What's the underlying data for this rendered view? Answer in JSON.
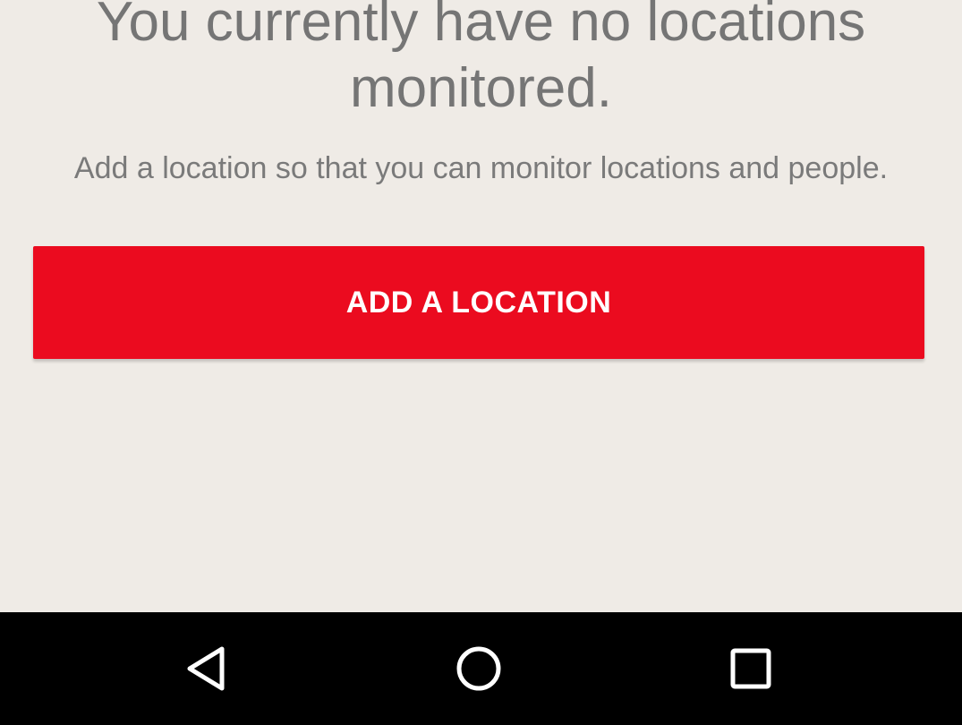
{
  "empty_state": {
    "title": "You currently have no locations monitored.",
    "subtitle": "Add a location so that you can monitor locations and people.",
    "button_label": "ADD A LOCATION"
  },
  "nav_bar": {
    "buttons": [
      {
        "name": "back",
        "icon": "triangle-back-icon"
      },
      {
        "name": "home",
        "icon": "circle-home-icon"
      },
      {
        "name": "recents",
        "icon": "square-recents-icon"
      }
    ]
  },
  "colors": {
    "background": "#efebe6",
    "accent": "#eb0b1f",
    "text_muted": "#757575",
    "nav_bar": "#000000"
  }
}
